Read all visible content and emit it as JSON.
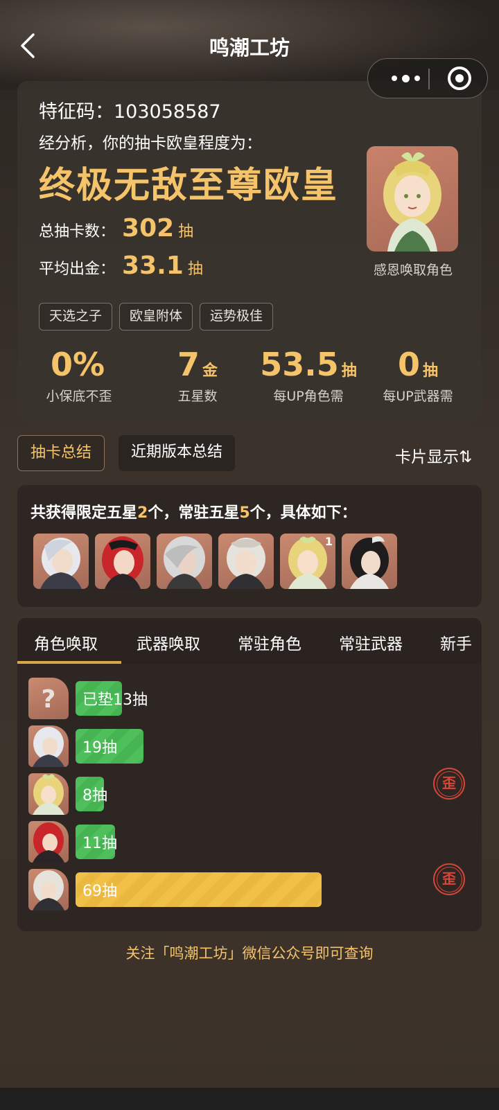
{
  "nav": {
    "title": "鸣潮工坊"
  },
  "profile": {
    "feature_code": "特征码：103058587",
    "analysis_text": "经分析，你的抽卡欧皇程度为：",
    "rank_title": "终极无敌至尊欧皇",
    "total_label": "总抽卡数：",
    "total_value": "302",
    "total_unit": "抽",
    "avg_label": "平均出金：",
    "avg_value": "33.1",
    "avg_unit": "抽",
    "thanks_label": "感恩唤取角色",
    "tags": [
      "天选之子",
      "欧皇附体",
      "运势极佳"
    ]
  },
  "metrics": [
    {
      "value": "0%",
      "unit": "",
      "label": "小保底不歪"
    },
    {
      "value": "7",
      "unit": "金",
      "label": "五星数"
    },
    {
      "value": "53.5",
      "unit": "抽",
      "label": "每UP角色需"
    },
    {
      "value": "0",
      "unit": "抽",
      "label": "每UP武器需"
    }
  ],
  "segment_tabs": {
    "active": "抽卡总结",
    "inactive": "近期版本总结"
  },
  "display_mode": "卡片显示⇅",
  "summary": {
    "prefix": "共获得限定五星",
    "limited_count": "2",
    "middle": "个，常驻五星",
    "standard_count": "5",
    "suffix": "个，具体如下：",
    "thumb_badge": "1"
  },
  "pool_tabs": [
    "角色唤取",
    "武器唤取",
    "常驻角色",
    "常驻武器",
    "新手"
  ],
  "pool_rows": [
    {
      "label": "已垫13抽",
      "pulls": 13,
      "color": "green",
      "off_banner": false
    },
    {
      "label": "19抽",
      "pulls": 19,
      "color": "green",
      "off_banner": false
    },
    {
      "label": "8抽",
      "pulls": 8,
      "color": "green",
      "off_banner": true
    },
    {
      "label": "11抽",
      "pulls": 11,
      "color": "green",
      "off_banner": false
    },
    {
      "label": "69抽",
      "pulls": 69,
      "color": "gold",
      "off_banner": true
    }
  ],
  "off_banner_mark": "歪",
  "unknown_mark": "?",
  "footer": "关注「鸣潮工坊」微信公众号即可查询",
  "colors": {
    "accent": "#f5c36a",
    "green": "#4fbf5c",
    "gold": "#f1c047",
    "red": "#d8463a"
  }
}
